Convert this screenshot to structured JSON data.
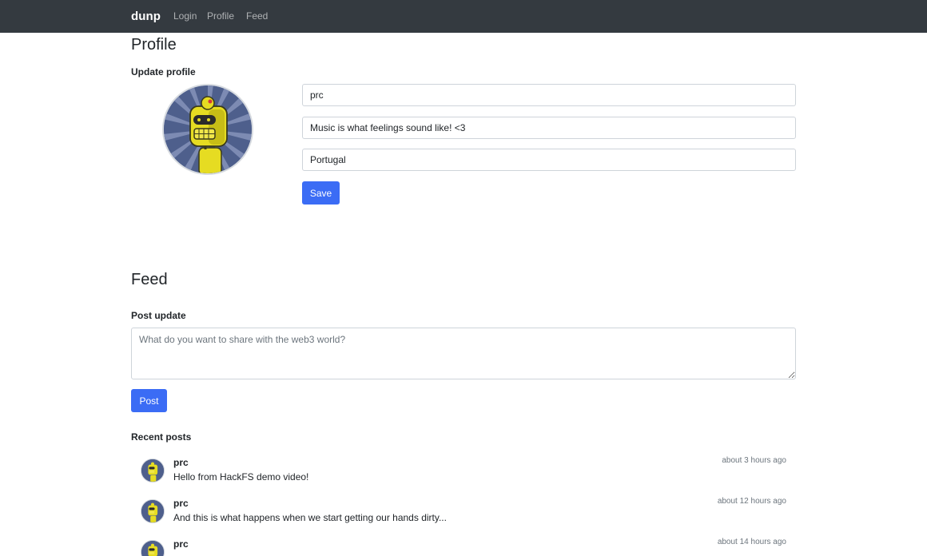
{
  "nav": {
    "brand": "dunp",
    "links": [
      "Login",
      "Profile",
      "Feed"
    ]
  },
  "profile": {
    "heading": "Profile",
    "subheading": "Update profile",
    "fields": {
      "name": "prc",
      "bio": "Music is what feelings sound like! <3",
      "location": "Portugal"
    },
    "save_label": "Save"
  },
  "feed": {
    "heading": "Feed",
    "post_label": "Post update",
    "post_placeholder": "What do you want to share with the web3 world?",
    "post_button": "Post",
    "recent_label": "Recent posts",
    "posts": [
      {
        "user": "prc",
        "text": "Hello from HackFS demo video!",
        "time": "about 3 hours ago"
      },
      {
        "user": "prc",
        "text": "And this is what happens when we start getting our hands dirty...",
        "time": "about 12 hours ago"
      },
      {
        "user": "prc",
        "text": "",
        "time": "about 14 hours ago"
      }
    ]
  },
  "colors": {
    "navbar": "#343a40",
    "primary_button": "#3b6cf5",
    "avatar_background": "#4e5f8c",
    "robot_yellow": "#e6dc22"
  },
  "icons": {
    "avatar": "yellow-robot-avatar"
  }
}
